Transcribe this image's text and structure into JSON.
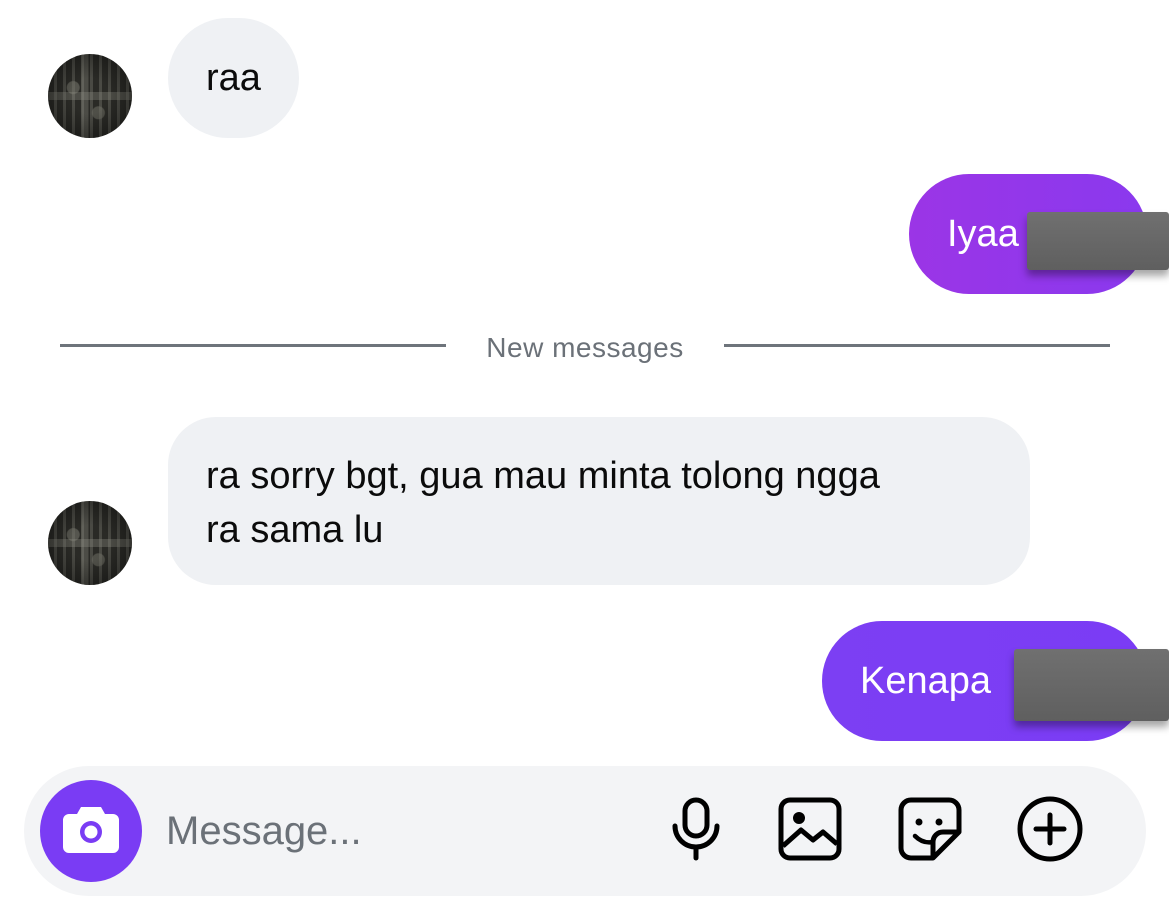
{
  "thread": {
    "messages": [
      {
        "direction": "incoming",
        "text": "raa"
      },
      {
        "direction": "outgoing",
        "text": "Iyaa"
      },
      {
        "direction": "incoming",
        "text": "ra sorry bgt, gua mau minta tolong ngga\nra sama lu"
      },
      {
        "direction": "outgoing",
        "text": "Kenapa"
      }
    ],
    "new_messages_divider": "New messages"
  },
  "composer": {
    "placeholder": "Message..."
  },
  "icons": {
    "camera": "camera-icon",
    "microphone": "microphone-icon",
    "gallery": "image-icon",
    "sticker": "sticker-icon",
    "more": "plus-circle-icon"
  },
  "colors": {
    "accent": "#7a3cf4",
    "outgoing_gradient_start": "#9b35e6",
    "outgoing_gradient_end": "#7b3cf5",
    "incoming_bubble": "#eff1f4",
    "composer_bg": "#f3f4f6",
    "divider": "#6e747b"
  }
}
